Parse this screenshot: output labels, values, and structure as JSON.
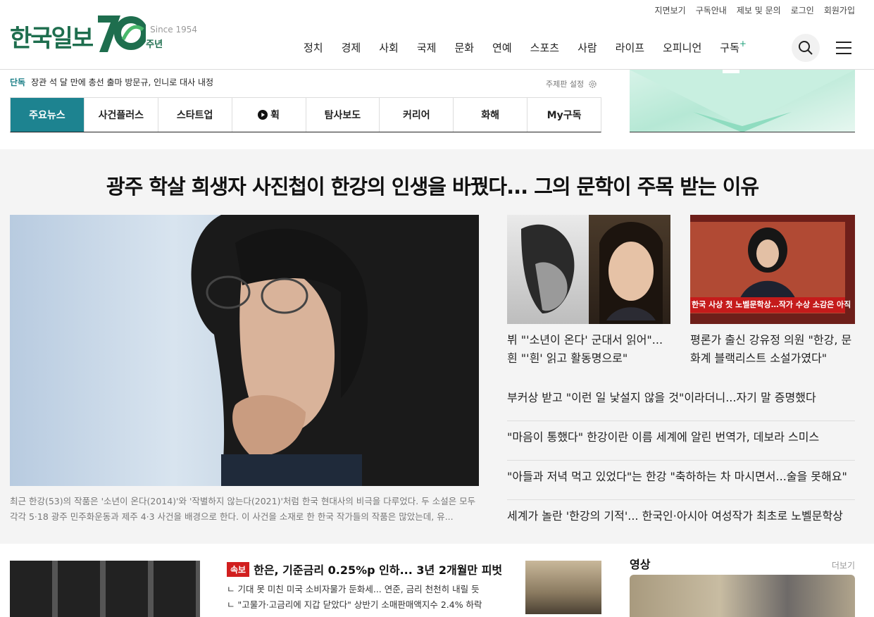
{
  "header": {
    "logo_text": "한국일보",
    "logo_70": "70",
    "since": "Since 1954",
    "anniversary": "주년",
    "util_links": [
      "지면보기",
      "구독안내",
      "제보 및 문의",
      "로그인",
      "회원가입"
    ],
    "nav": [
      "정치",
      "경제",
      "사회",
      "국제",
      "문화",
      "연예",
      "스포츠",
      "사람",
      "라이프",
      "오피니언",
      "구독"
    ],
    "nav_plus": "+"
  },
  "breaking": {
    "tag": "단독",
    "text": "장관 석 달 만에 총선 출마 방문규, 인니로 대사 내정"
  },
  "topic_setting": "주제판 설정",
  "tabs": [
    {
      "label": "주요뉴스",
      "icon": ""
    },
    {
      "label": "사건플러스",
      "icon": ""
    },
    {
      "label": "스타트업",
      "icon": ""
    },
    {
      "label": "휙",
      "icon": "play-circle-icon"
    },
    {
      "label": "탐사보도",
      "icon": ""
    },
    {
      "label": "커리어",
      "icon": ""
    },
    {
      "label": "화해",
      "icon": ""
    },
    {
      "label": "My구독",
      "icon": ""
    }
  ],
  "headline": {
    "title": "광주 학살 희생자 사진첩이 한강의 인생을 바꿨다... 그의 문학이 주목 받는 이유",
    "caption": "최근 한강(53)의 작품은 '소년이 온다(2014)'와 '작별하지 않는다(2021)'처럼 한국 현대사의 비극을 다루었다. 두 소설은 모두 각각 5·18 광주 민주화운동과 제주 4·3 사건을 배경으로 한다. 이 사건을 소재로 한 한국 작가들의 작품은 많았는데, 유..."
  },
  "thumbs": [
    {
      "title": "뷔 \"'소년이 온다' 군대서 읽어\"... 흰 \"'흰' 읽고 활동명으로\""
    },
    {
      "title": "평론가 출신 강유정 의원 \"한강, 문화계 블랙리스트 소설가였다\"",
      "tv_caption": "한국 사상 첫 노벨문학상…작가 수상 소감은 아직"
    }
  ],
  "side_list": [
    "부커상 받고 \"이런 일 낯설지 않을 것\"이라더니...자기 말 증명했다",
    "\"마음이 통했다\" 한강이란 이름 세계에 알린 번역가, 데보라 스미스",
    "\"아들과 저녁 먹고 있었다\"는 한강 \"축하하는 차 마시면서...술을 못해요\"",
    "세계가 놀란 '한강의 기적'... 한국인·아시아 여성작가 최초로 노벨문학상"
  ],
  "bottom": {
    "badge": "속보",
    "title": "한은, 기준금리 0.25%p 인하... 3년 2개월만 피벗",
    "subs": [
      "ㄴ 기대 못 미친 미국 소비자물가 둔화세... 연준, 금리 천천히 내릴 듯",
      "ㄴ \"고물가·고금리에 지갑 닫았다\" 상반기 소매판매액지수 2.4% 하락"
    ]
  },
  "video": {
    "title": "영상",
    "more": "더보기"
  },
  "colors": {
    "brand": "#1e6e4e",
    "tab_active": "#1d8390",
    "badge": "#d11f1f"
  }
}
